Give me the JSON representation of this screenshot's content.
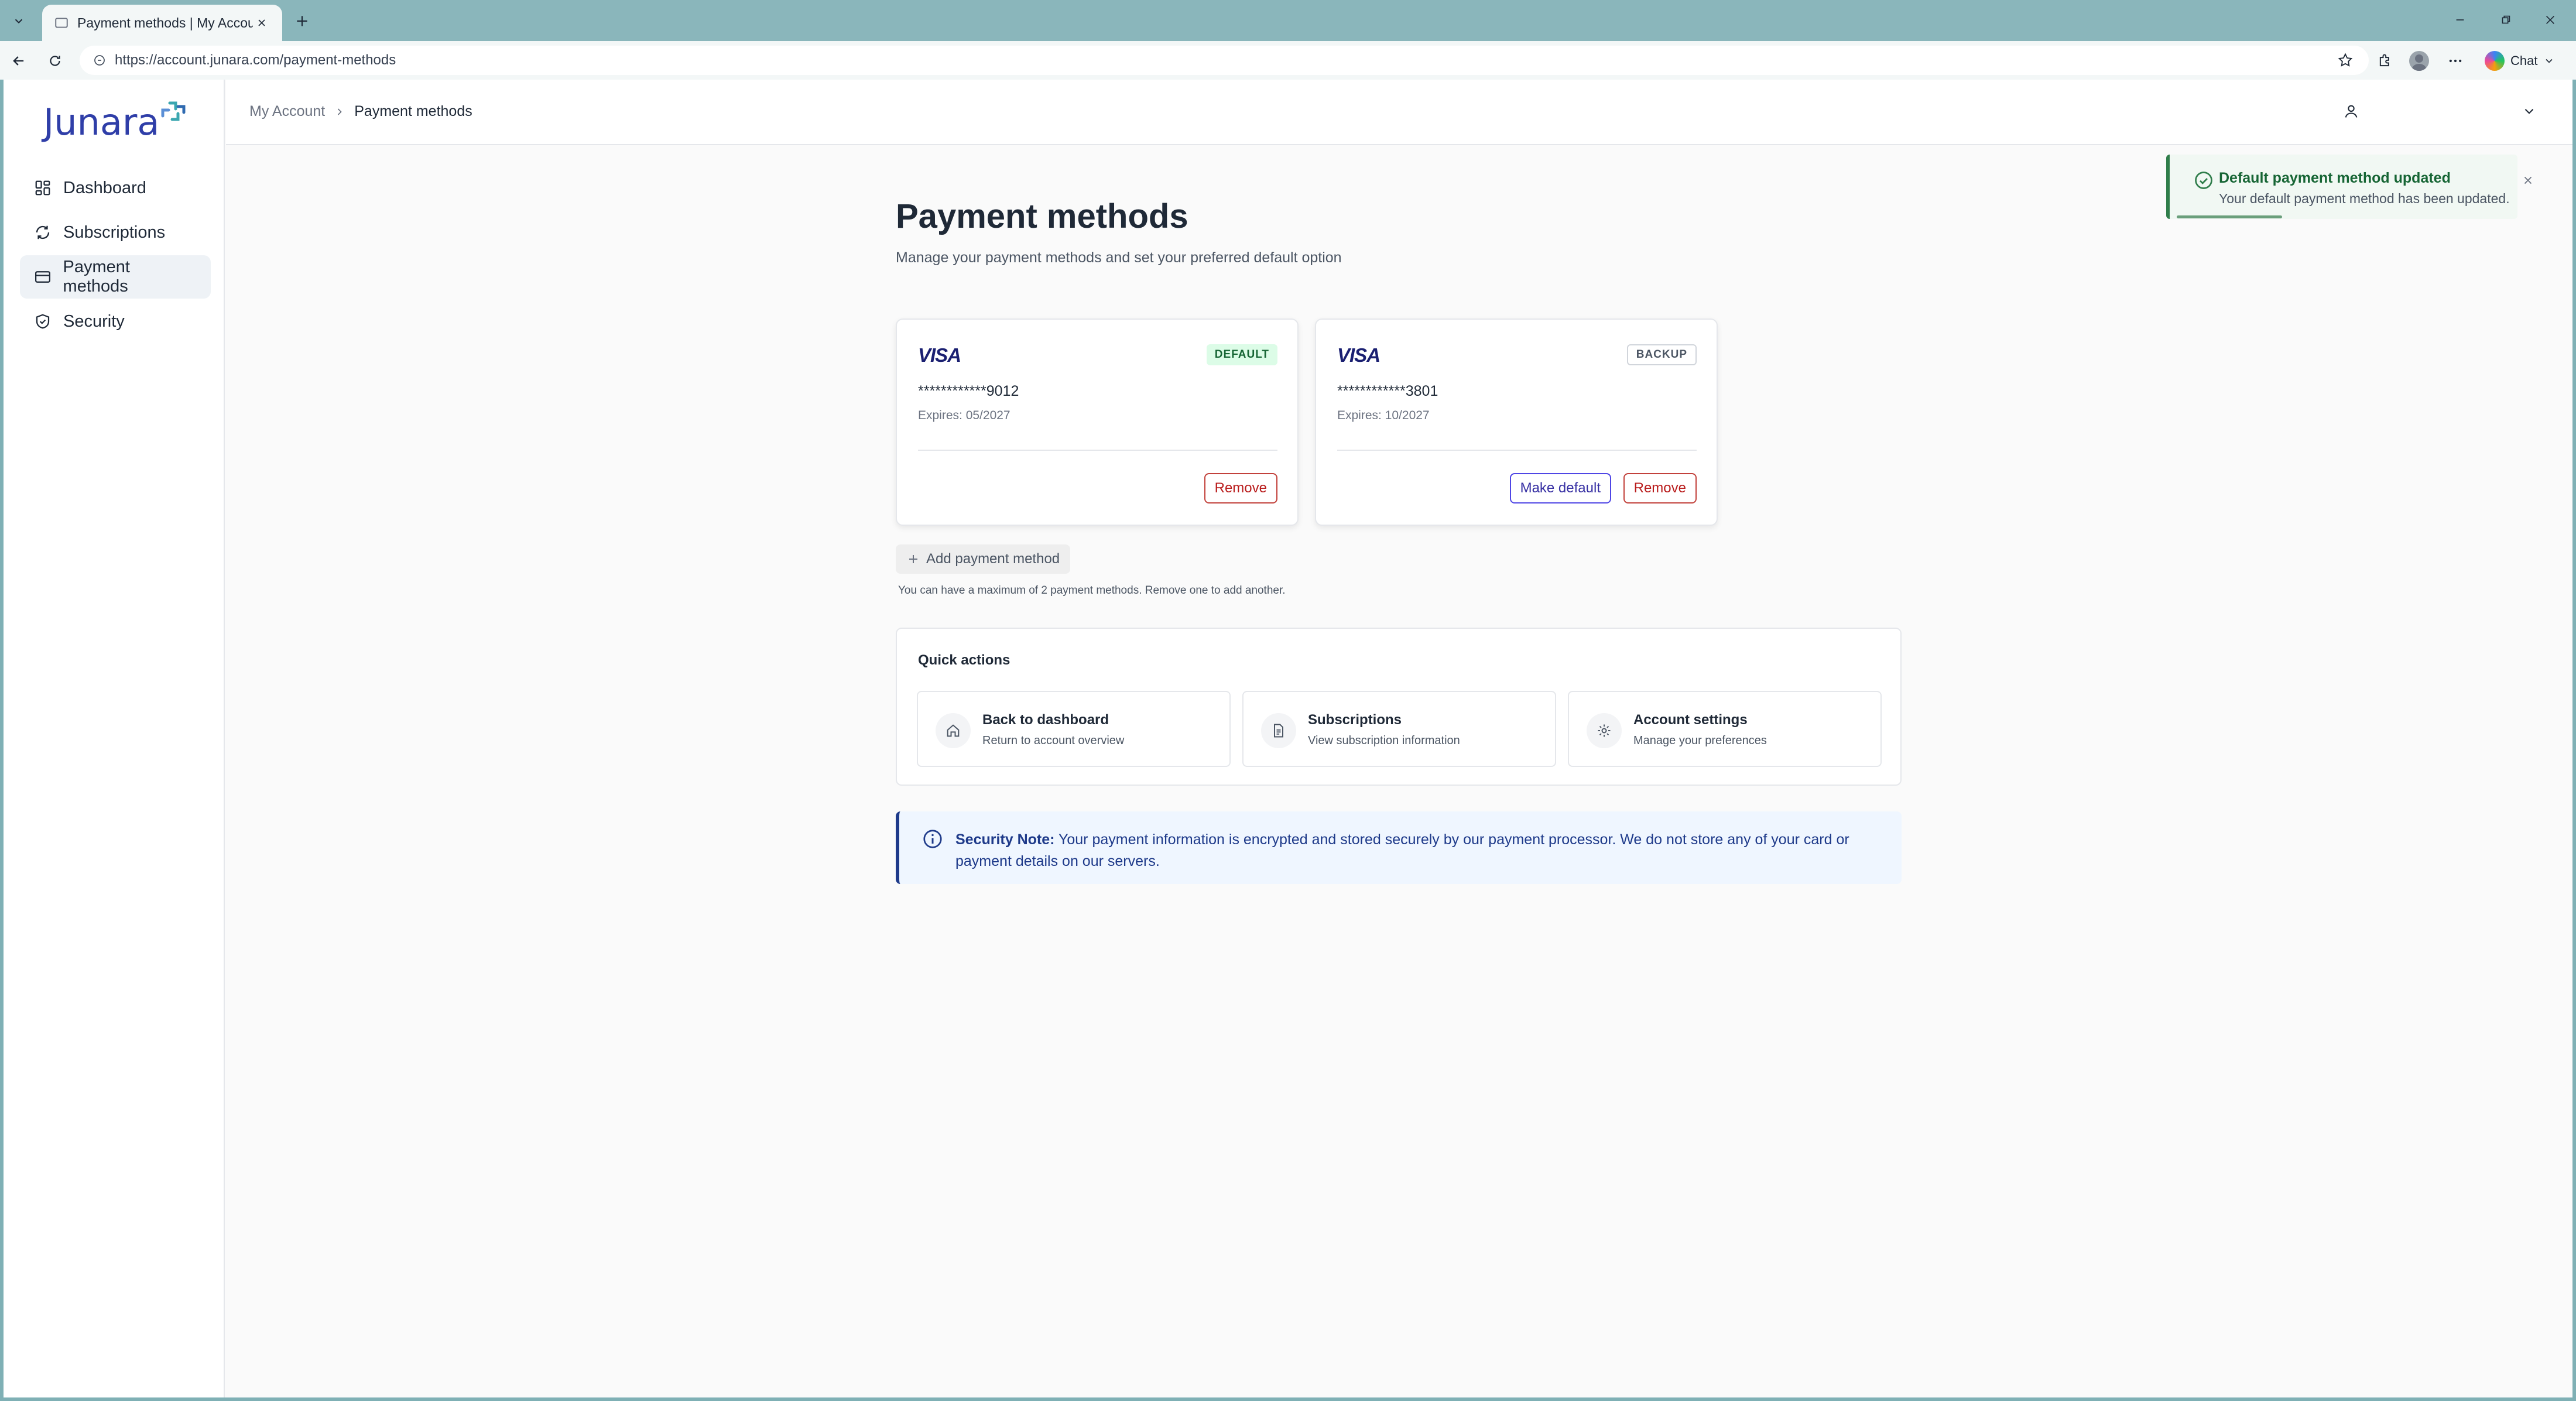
{
  "browser": {
    "tab_title": "Payment methods | My Account",
    "url": "https://account.junara.com/payment-methods",
    "chat_label": "Chat"
  },
  "app": {
    "logo_text": "Junara",
    "brand_color": "#2f3ea8"
  },
  "sidebar": {
    "items": [
      {
        "label": "Dashboard",
        "icon": "grid-icon",
        "active": false
      },
      {
        "label": "Subscriptions",
        "icon": "refresh-icon",
        "active": false
      },
      {
        "label": "Payment methods",
        "icon": "credit-card-icon",
        "active": true
      },
      {
        "label": "Security",
        "icon": "shield-icon",
        "active": false
      }
    ]
  },
  "breadcrumb": {
    "root": "My Account",
    "current": "Payment methods"
  },
  "toast": {
    "title": "Default payment method updated",
    "message": "Your default payment method has been updated.",
    "status_color": "#2f7d4a"
  },
  "page": {
    "title": "Payment methods",
    "subtitle": "Manage your payment methods and set your preferred default option"
  },
  "cards": [
    {
      "brand": "VISA",
      "badge": "DEFAULT",
      "number": "************9012",
      "expires": "Expires: 05/2027",
      "make_default_label": null,
      "remove_label": "Remove"
    },
    {
      "brand": "VISA",
      "badge": "BACKUP",
      "number": "************3801",
      "expires": "Expires: 10/2027",
      "make_default_label": "Make default",
      "remove_label": "Remove"
    }
  ],
  "add_payment": {
    "label": "Add payment method",
    "note": "You can have a maximum of 2 payment methods. Remove one to add another."
  },
  "quick_actions": {
    "title": "Quick actions",
    "items": [
      {
        "title": "Back to dashboard",
        "subtitle": "Return to account overview",
        "icon": "home-icon"
      },
      {
        "title": "Subscriptions",
        "subtitle": "View subscription information",
        "icon": "document-icon"
      },
      {
        "title": "Account settings",
        "subtitle": "Manage your preferences",
        "icon": "gear-icon"
      }
    ]
  },
  "security_note": {
    "label": "Security Note:",
    "text": "Your payment information is encrypted and stored securely by our payment processor. We do not store any of your card or payment details on our servers."
  }
}
